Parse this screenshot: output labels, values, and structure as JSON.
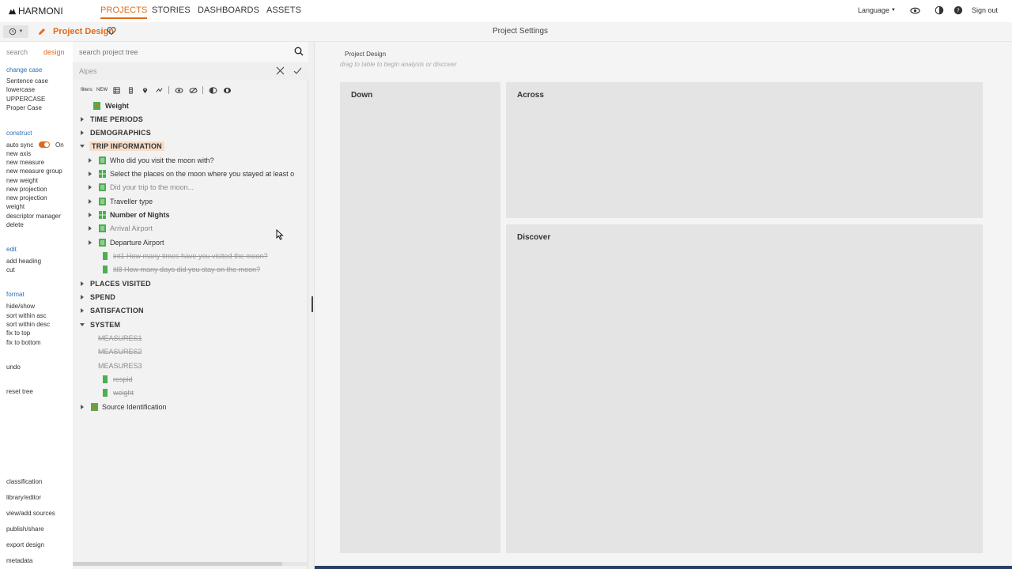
{
  "app": {
    "logo": "HARMONI",
    "nav_tabs": [
      "PROJECTS",
      "STORIES",
      "DASHBOARDS",
      "ASSETS"
    ],
    "language": "Language",
    "sign_out": "Sign out"
  },
  "subbar": {
    "project_title": "Project Design",
    "settings_title": "Project Settings"
  },
  "leftmenu": {
    "tab_search": "search",
    "tab_design": "design",
    "change_case": {
      "heading": "change case",
      "items": [
        "Sentence case",
        "lowercase",
        "UPPERCASE",
        "Proper Case"
      ]
    },
    "construct": {
      "heading": "construct",
      "auto_sync": "auto sync",
      "auto_sync_state": "On",
      "items": [
        "new axis",
        "new measure",
        "new measure group",
        "new weight",
        "new projection",
        "new projection",
        "weight",
        "descriptor manager",
        "delete"
      ]
    },
    "edit": {
      "heading": "edit",
      "items": [
        "add heading",
        "cut"
      ]
    },
    "format": {
      "heading": "format",
      "items": [
        "hide/show",
        "sort within asc",
        "sort within desc",
        "fix to top",
        "fix to bottom"
      ]
    },
    "undo": "undo",
    "reset_tree": "reset tree",
    "bottom_items": [
      "classification",
      "library/editor",
      "view/add sources",
      "publish/share",
      "export design",
      "metadata"
    ]
  },
  "tree": {
    "search_placeholder": "search project tree",
    "filter_value": "Alpes",
    "filters_label": "filters:",
    "filters_new": "NEW",
    "rows": [
      {
        "label": "Weight",
        "kind": "weight"
      },
      {
        "label": "TIME PERIODS",
        "kind": "section"
      },
      {
        "label": "DEMOGRAPHICS",
        "kind": "section"
      },
      {
        "label": "TRIP INFORMATION",
        "kind": "section-open"
      },
      {
        "label": "Who did you visit the moon with?",
        "kind": "question"
      },
      {
        "label": "Select the places on the moon where you stayed at least o",
        "kind": "question"
      },
      {
        "label": "Did your trip to the moon...",
        "kind": "question-dim"
      },
      {
        "label": "Traveller type",
        "kind": "question"
      },
      {
        "label": "Number of Nights",
        "kind": "question-bold"
      },
      {
        "label": "Arrival Airport",
        "kind": "question-dim"
      },
      {
        "label": "Departure Airport",
        "kind": "question"
      },
      {
        "label": "int1 How many times have you visited the moon?",
        "kind": "strike-child"
      },
      {
        "label": "itl8 How many days did you stay on the moon?",
        "kind": "strike-child"
      },
      {
        "label": "PLACES VISITED",
        "kind": "section"
      },
      {
        "label": "SPEND",
        "kind": "section"
      },
      {
        "label": "SATISFACTION",
        "kind": "section"
      },
      {
        "label": "SYSTEM",
        "kind": "section-open"
      },
      {
        "label": "MEASURES1",
        "kind": "measure-strike"
      },
      {
        "label": "MEASURES2",
        "kind": "measure-strike"
      },
      {
        "label": "MEASURES3",
        "kind": "measure"
      },
      {
        "label": "respid",
        "kind": "strike-child"
      },
      {
        "label": "weight",
        "kind": "strike-child"
      },
      {
        "label": "Source Identification",
        "kind": "source"
      }
    ]
  },
  "main": {
    "breadcrumb": "Project Design",
    "hint": "drag to table to begin analysis or discover",
    "zone_down": "Down",
    "zone_across": "Across",
    "zone_discover": "Discover"
  },
  "colors": {
    "accent": "#e06a1a",
    "link": "#2a6db5",
    "section_highlight": "#f6dcc8",
    "question_icon": "#4caf50"
  }
}
